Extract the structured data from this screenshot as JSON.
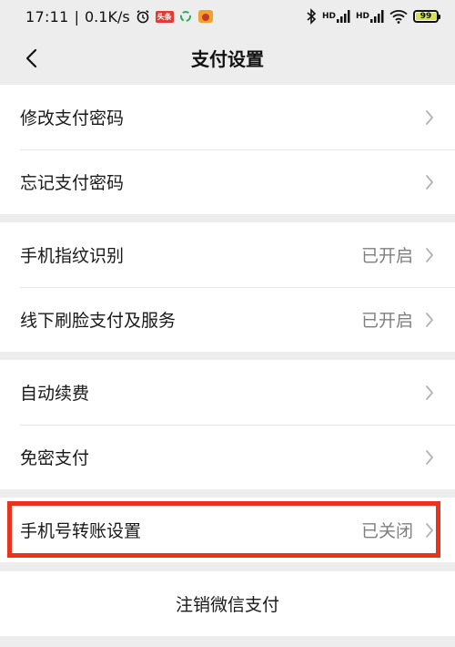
{
  "status_bar": {
    "time": "17:11",
    "net_speed": "0.1K/s",
    "app_badge": "头条",
    "battery": "99",
    "signal_label_1": "HD",
    "signal_label_2": "HD"
  },
  "nav": {
    "title": "支付设置"
  },
  "groups": [
    {
      "rows": [
        {
          "label": "修改支付密码",
          "value": ""
        },
        {
          "label": "忘记支付密码",
          "value": ""
        }
      ]
    },
    {
      "rows": [
        {
          "label": "手机指纹识别",
          "value": "已开启"
        },
        {
          "label": "线下刷脸支付及服务",
          "value": "已开启"
        }
      ]
    },
    {
      "rows": [
        {
          "label": "自动续费",
          "value": ""
        },
        {
          "label": "免密支付",
          "value": ""
        }
      ]
    },
    {
      "rows": [
        {
          "label": "手机号转账设置",
          "value": "已关闭"
        }
      ]
    }
  ],
  "action": {
    "label": "注销微信支付"
  },
  "colors": {
    "highlight": "#e8341c"
  },
  "icons": {
    "back": "chevron-left-icon",
    "row_arrow": "chevron-right-icon",
    "alarm": "alarm-icon",
    "recycle": "recycle-icon",
    "app": "app-icon",
    "bluetooth": "bluetooth-icon",
    "wifi": "wifi-icon"
  }
}
